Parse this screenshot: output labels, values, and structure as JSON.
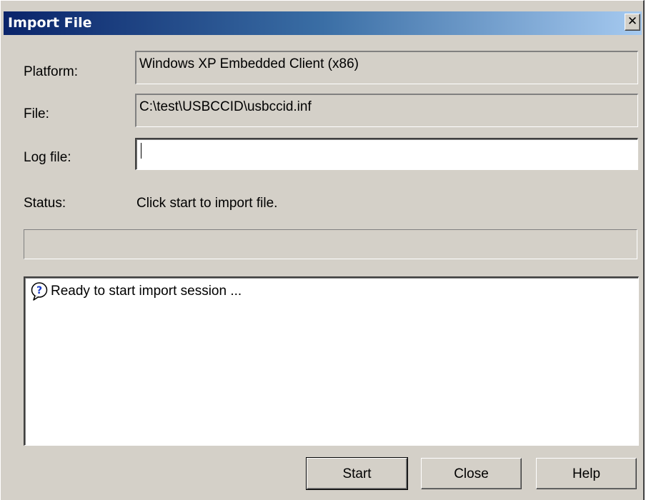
{
  "window": {
    "title": "Import File",
    "close_glyph": "✕"
  },
  "form": {
    "platform_label": "Platform:",
    "platform_value": "Windows XP Embedded Client (x86)",
    "file_label": "File:",
    "file_value": "C:\\test\\USBCCID\\usbccid.inf",
    "logfile_label": "Log file:",
    "logfile_value": "",
    "status_label": "Status:",
    "status_value": "Click start to import file."
  },
  "progress": {
    "fraction": 0
  },
  "log": {
    "entries": [
      {
        "icon": "question-icon",
        "text": "Ready to start import session ..."
      }
    ]
  },
  "buttons": {
    "start_label": "Start",
    "close_label": "Close",
    "help_label": "Help"
  },
  "colors": {
    "titlebar_start": "#0a246a",
    "titlebar_end": "#a6caf0",
    "dialog_face": "#d4d0c8"
  }
}
